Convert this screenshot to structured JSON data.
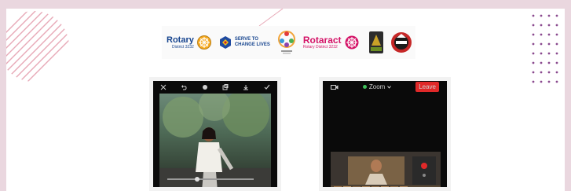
{
  "logos": {
    "rotary": {
      "name": "Rotary",
      "sub": "District 3232"
    },
    "serve": {
      "line1": "SERVE TO",
      "line2": "CHANGE LIVES"
    },
    "rotaract": {
      "name": "Rotaract",
      "sub": "Rotary District 3232"
    }
  },
  "phone_right": {
    "zoom_label": "Zoom",
    "leave_label": "Leave"
  },
  "colors": {
    "page_background": "#ead7df",
    "rotary_blue": "#17458f",
    "rotaract_pink": "#d41367",
    "dot_purple": "#8a4a8f",
    "leave_red": "#e02929"
  },
  "icons": {
    "left_phone_toolbar": [
      "close-icon",
      "undo-icon",
      "brush-icon",
      "layers-icon",
      "download-icon",
      "check-icon"
    ],
    "right_phone_toolbar": [
      "camera-switch-icon",
      "zoom-dropdown-icon"
    ]
  }
}
